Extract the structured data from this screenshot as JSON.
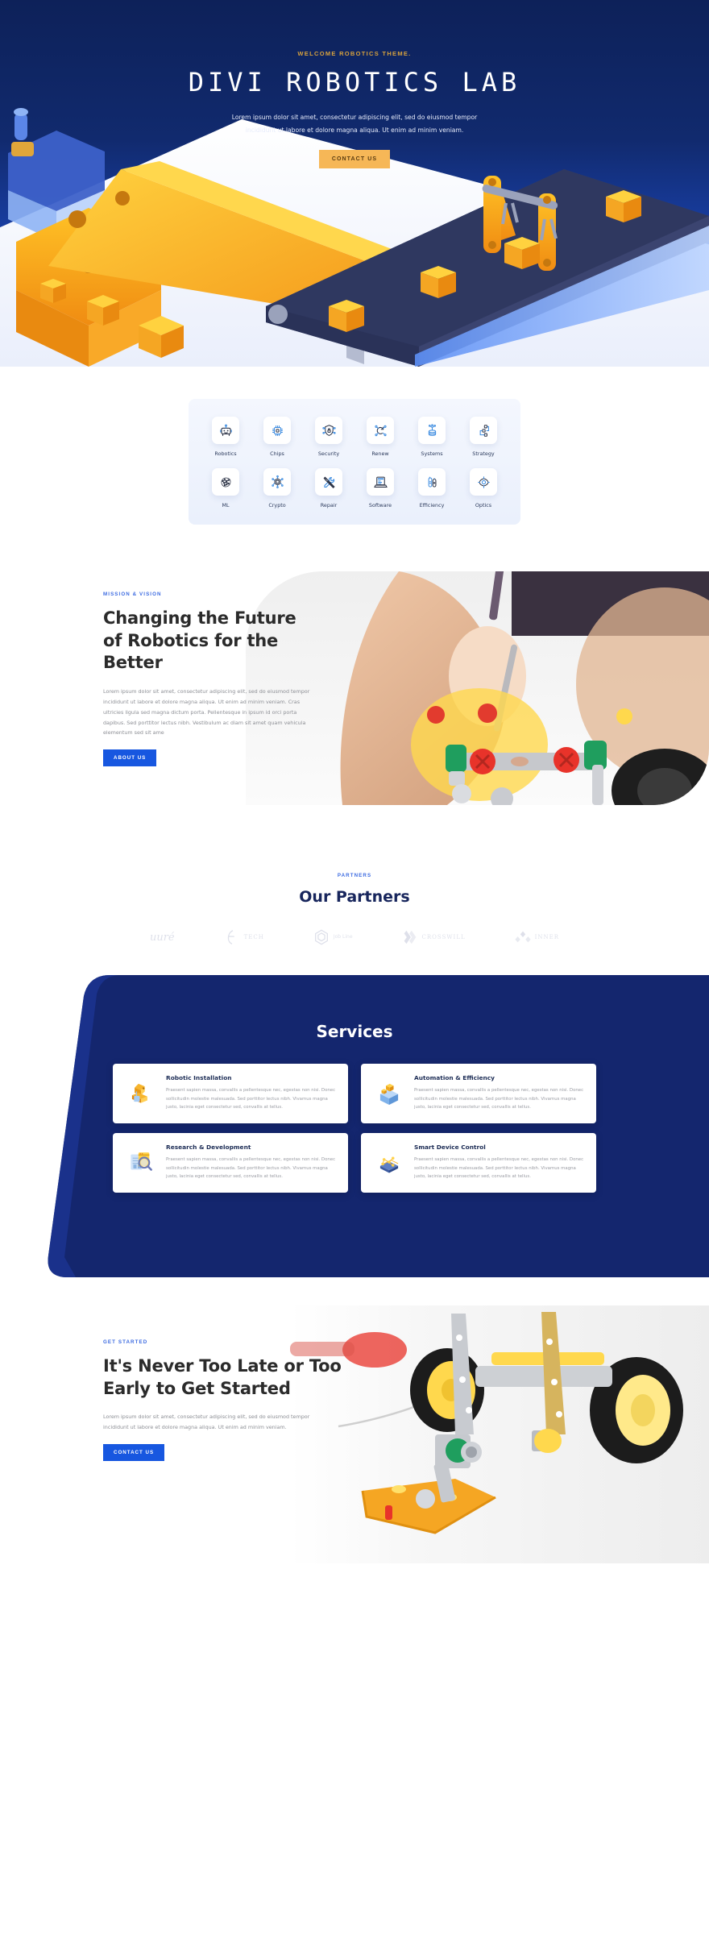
{
  "hero": {
    "eyebrow": "WELCOME ROBOTICS THEME.",
    "title": "DIVI ROBOTICS LAB",
    "subtitle": "Lorem ipsum dolor sit amet, consectetur adipiscing elit, sed do eiusmod tempor incididunt ut labore et dolore magna aliqua. Ut enim ad minim veniam.",
    "cta_label": "CONTACT US",
    "accent_gold": "#f6b757",
    "bg_navy": "#0d2159",
    "bg_blue": "#1b45b5"
  },
  "icon_grid": {
    "items": [
      {
        "label": "Robotics",
        "icon": "robot-icon"
      },
      {
        "label": "Chips",
        "icon": "chip-icon"
      },
      {
        "label": "Security",
        "icon": "shield-lock-icon"
      },
      {
        "label": "Renew",
        "icon": "renew-network-icon"
      },
      {
        "label": "Systems",
        "icon": "server-antenna-icon"
      },
      {
        "label": "Strategy",
        "icon": "flowchart-icon"
      },
      {
        "label": "ML",
        "icon": "neural-brain-icon"
      },
      {
        "label": "Crypto",
        "icon": "hexagon-node-icon"
      },
      {
        "label": "Repair",
        "icon": "wrench-screwdriver-icon"
      },
      {
        "label": "Software",
        "icon": "laptop-code-icon"
      },
      {
        "label": "Efficiency",
        "icon": "battery-icon"
      },
      {
        "label": "Optics",
        "icon": "eye-lens-icon"
      }
    ]
  },
  "mission": {
    "eyebrow": "MISSION & VISION",
    "heading": "Changing the Future of Robotics for the Better",
    "body": "Lorem ipsum dolor sit amet, consectetur adipiscing elit, sed do eiusmod tempor incididunt ut labore et dolore magna aliqua. Ut enim ad minim veniam. Cras ultricies ligula sed magna dictum porta. Pellentesque in ipsum id orci porta dapibus. Sed porttitor lectus nibh. Vestibulum ac diam sit amet quam vehicula elementum sed sit ame",
    "cta_label": "ABOUT US",
    "photo_alt": "hands-assembling-robot-kit-photo"
  },
  "partners": {
    "eyebrow": "PARTNERS",
    "title": "Our Partners",
    "logos": [
      {
        "name": "uuré",
        "style": "script"
      },
      {
        "name": "TECH",
        "style": "mark-serif"
      },
      {
        "name": "Job Line",
        "style": "mark-two-line"
      },
      {
        "name": "CROSSWILL",
        "style": "mark-serif"
      },
      {
        "name": "INNER",
        "style": "mark-serif"
      }
    ]
  },
  "services": {
    "title": "Services",
    "panel_color": "#14266e",
    "cards": [
      {
        "title": "Robotic Installation",
        "text": "Praesent sapien massa, convallis a pellentesque nec, egestas non nisi. Donec sollicitudin molestie malesuada. Sed porttitor lectus nibh. Vivamus magna justo, lacinia eget consectetur sed, convallis at tellus.",
        "icon": "robot-arm-icon"
      },
      {
        "title": "Automation & Efficiency",
        "text": "Praesent sapien massa, convallis a pellentesque nec, egestas non nisi. Donec sollicitudin molestie malesuada. Sed porttitor lectus nibh. Vivamus magna justo, lacinia eget consectetur sed, convallis at tellus.",
        "icon": "open-box-icon"
      },
      {
        "title": "Research & Development",
        "text": "Praesent sapien massa, convallis a pellentesque nec, egestas non nisi. Donec sollicitudin molestie malesuada. Sed porttitor lectus nibh. Vivamus magna justo, lacinia eget consectetur sed, convallis at tellus.",
        "icon": "magnifier-chart-icon"
      },
      {
        "title": "Smart Device Control",
        "text": "Praesent sapien massa, convallis a pellentesque nec, egestas non nisi. Donec sollicitudin molestie malesuada. Sed porttitor lectus nibh. Vivamus magna justo, lacinia eget consectetur sed, convallis at tellus.",
        "icon": "network-tablet-icon"
      }
    ]
  },
  "get_started": {
    "eyebrow": "GET STARTED",
    "heading": "It's Never Too Late or Too Early to Get Started",
    "body": "Lorem ipsum dolor sit amet, consectetur adipiscing elit, sed do eiusmod tempor incididunt ut labore et dolore magna aliqua. Ut enim ad minim veniam.",
    "cta_label": "CONTACT US",
    "photo_alt": "robot-car-wheels-photo"
  }
}
